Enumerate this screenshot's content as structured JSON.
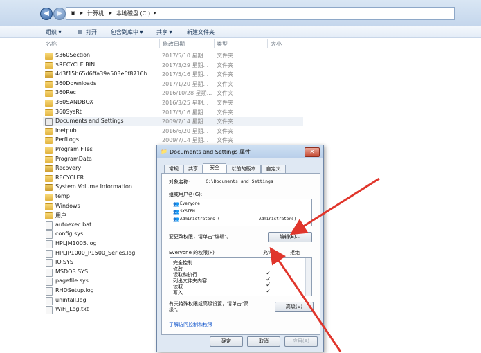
{
  "address": {
    "parts": [
      "计算机",
      "本地磁盘 (C:)"
    ]
  },
  "toolbar": {
    "organize": "组织 ▾",
    "open": "打开",
    "include": "包含到库中 ▾",
    "share": "共享 ▾",
    "newfolder": "新建文件夹"
  },
  "columns": {
    "name": "名称",
    "date": "修改日期",
    "type": "类型",
    "size": "大小"
  },
  "files": [
    {
      "name": "$360Section",
      "date": "2017/5/10 星期...",
      "type": "文件夹",
      "icon": "folder"
    },
    {
      "name": "$RECYCLE.BIN",
      "date": "2017/3/29 星期...",
      "type": "文件夹",
      "icon": "folder"
    },
    {
      "name": "4d3f15b65d6ffa39a503e6f8716b",
      "date": "2017/5/16 星期...",
      "type": "文件夹",
      "icon": "lockfolder"
    },
    {
      "name": "360Downloads",
      "date": "2017/1/20 星期...",
      "type": "文件夹",
      "icon": "folder"
    },
    {
      "name": "360Rec",
      "date": "2016/10/28 星期...",
      "type": "文件夹",
      "icon": "folder"
    },
    {
      "name": "360SANDBOX",
      "date": "2016/3/25 星期...",
      "type": "文件夹",
      "icon": "folder"
    },
    {
      "name": "360SysRt",
      "date": "2017/5/16 星期...",
      "type": "文件夹",
      "icon": "folder"
    },
    {
      "name": "Documents and Settings",
      "date": "2009/7/14 星期...",
      "type": "文件夹",
      "icon": "shortcut"
    },
    {
      "name": "inetpub",
      "date": "2016/6/20 星期...",
      "type": "文件夹",
      "icon": "folder"
    },
    {
      "name": "PerfLogs",
      "date": "2009/7/14 星期...",
      "type": "文件夹",
      "icon": "folder"
    },
    {
      "name": "Program Files",
      "date": "",
      "type": "",
      "icon": "folder"
    },
    {
      "name": "ProgramData",
      "date": "",
      "type": "",
      "icon": "folder"
    },
    {
      "name": "Recovery",
      "date": "",
      "type": "",
      "icon": "lockfolder"
    },
    {
      "name": "RECYCLER",
      "date": "",
      "type": "",
      "icon": "folder"
    },
    {
      "name": "System Volume Information",
      "date": "",
      "type": "",
      "icon": "lockfolder"
    },
    {
      "name": "temp",
      "date": "",
      "type": "",
      "icon": "folder"
    },
    {
      "name": "Windows",
      "date": "",
      "type": "",
      "icon": "folder"
    },
    {
      "name": "用户",
      "date": "",
      "type": "",
      "icon": "folder"
    },
    {
      "name": "autoexec.bat",
      "date": "",
      "type": "",
      "icon": "file"
    },
    {
      "name": "config.sys",
      "date": "",
      "type": "",
      "icon": "file"
    },
    {
      "name": "HPLJM1005.log",
      "date": "",
      "type": "",
      "icon": "file"
    },
    {
      "name": "HPLJP1000_P1500_Series.log",
      "date": "",
      "type": "",
      "icon": "file"
    },
    {
      "name": "IO.SYS",
      "date": "",
      "type": "",
      "icon": "file"
    },
    {
      "name": "MSDOS.SYS",
      "date": "",
      "type": "",
      "icon": "file"
    },
    {
      "name": "pagefile.sys",
      "date": "",
      "type": "",
      "icon": "file"
    },
    {
      "name": "RHDSetup.log",
      "date": "",
      "type": "",
      "icon": "file"
    },
    {
      "name": "unintall.log",
      "date": "",
      "type": "",
      "icon": "file"
    },
    {
      "name": "WiFi_Log.txt",
      "date": "",
      "type": "",
      "icon": "file"
    }
  ],
  "dialog": {
    "title": "Documents and Settings 属性",
    "close": "✕",
    "tabs": [
      "常规",
      "共享",
      "安全",
      "以前的版本",
      "自定义"
    ],
    "object_label": "对象名称:",
    "object_value": "C:\\Documents and Settings",
    "groups_label": "组或用户名(G):",
    "groups": [
      "Everyone",
      "SYSTEM",
      "Administrators (",
      "Administrators)"
    ],
    "change_text": "要更改权限，请单击\"编辑\"。",
    "edit_button": "编辑(E)...",
    "perm_header": "Everyone 的权限(P)",
    "allow": "允许",
    "deny": "拒绝",
    "permissions": [
      "完全控制",
      "修改",
      "读取和执行",
      "列出文件夹内容",
      "读取",
      "写入"
    ],
    "allowed": [
      "",
      "",
      "✓",
      "✓",
      "✓",
      "✓"
    ],
    "special_text1": "有关特殊权限或高级设置，请单击\"高",
    "special_text2": "级\"。",
    "advanced_button": "高级(V)",
    "link": "了解访问控制和权限",
    "ok": "确定",
    "cancel": "取消",
    "apply": "应用(A)"
  }
}
